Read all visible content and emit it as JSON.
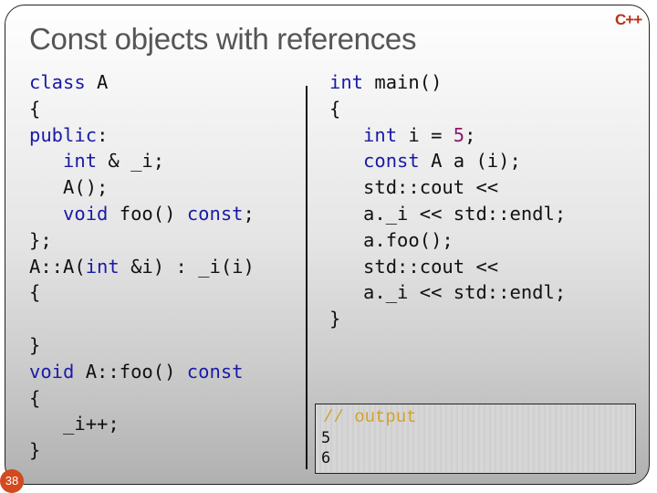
{
  "slide": {
    "title": "Const objects with references",
    "logo": "C++",
    "page_number": "38"
  },
  "left_code": [
    [
      {
        "t": "class",
        "k": "kw"
      },
      {
        "t": " A",
        "k": ""
      }
    ],
    [
      {
        "t": "{",
        "k": ""
      }
    ],
    [
      {
        "t": "public",
        "k": "kw"
      },
      {
        "t": ":",
        "k": ""
      }
    ],
    [
      {
        "t": "   ",
        "k": ""
      },
      {
        "t": "int",
        "k": "kw"
      },
      {
        "t": " & _i;",
        "k": ""
      }
    ],
    [
      {
        "t": "   A();",
        "k": ""
      }
    ],
    [
      {
        "t": "   ",
        "k": ""
      },
      {
        "t": "void",
        "k": "kw"
      },
      {
        "t": " foo() ",
        "k": ""
      },
      {
        "t": "const",
        "k": "kw"
      },
      {
        "t": ";",
        "k": ""
      }
    ],
    [
      {
        "t": "};",
        "k": ""
      }
    ],
    [
      {
        "t": "A::A(",
        "k": ""
      },
      {
        "t": "int",
        "k": "kw"
      },
      {
        "t": " &i) : _i(i)",
        "k": ""
      }
    ],
    [
      {
        "t": "{",
        "k": ""
      }
    ],
    [
      {
        "t": "",
        "k": ""
      }
    ],
    [
      {
        "t": "}",
        "k": ""
      }
    ],
    [
      {
        "t": "void",
        "k": "kw"
      },
      {
        "t": " A::foo() ",
        "k": ""
      },
      {
        "t": "const",
        "k": "kw"
      }
    ],
    [
      {
        "t": "{",
        "k": ""
      }
    ],
    [
      {
        "t": "   _i++;",
        "k": ""
      }
    ],
    [
      {
        "t": "}",
        "k": ""
      }
    ]
  ],
  "right_code": [
    [
      {
        "t": "int",
        "k": "kw"
      },
      {
        "t": " main()",
        "k": ""
      }
    ],
    [
      {
        "t": "{",
        "k": ""
      }
    ],
    [
      {
        "t": "   ",
        "k": ""
      },
      {
        "t": "int",
        "k": "kw"
      },
      {
        "t": " i = ",
        "k": ""
      },
      {
        "t": "5",
        "k": "num"
      },
      {
        "t": ";",
        "k": ""
      }
    ],
    [
      {
        "t": "   ",
        "k": ""
      },
      {
        "t": "const",
        "k": "kw"
      },
      {
        "t": " A a (i);",
        "k": ""
      }
    ],
    [
      {
        "t": "   std::cout <<",
        "k": ""
      }
    ],
    [
      {
        "t": "   a._i << std::endl;",
        "k": ""
      }
    ],
    [
      {
        "t": "   a.foo();",
        "k": ""
      }
    ],
    [
      {
        "t": "   std::cout <<",
        "k": ""
      }
    ],
    [
      {
        "t": "   a._i << std::endl;",
        "k": ""
      }
    ],
    [
      {
        "t": "}",
        "k": ""
      }
    ]
  ],
  "output_box": {
    "comment": "// output",
    "lines": [
      "5",
      "6"
    ]
  }
}
